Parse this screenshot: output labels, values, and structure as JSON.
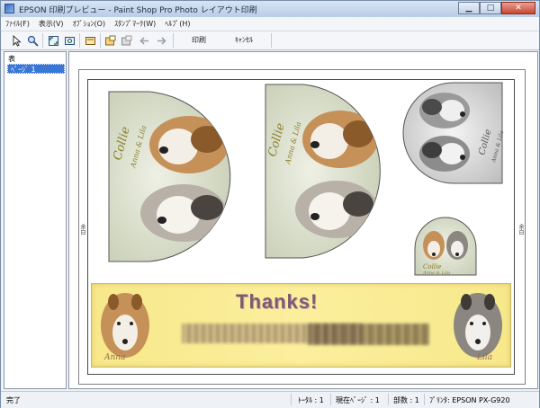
{
  "window": {
    "title": "EPSON 印刷プレビュー - Paint Shop Pro Photo レイアウト印刷"
  },
  "menu": [
    "ﾌｧｲﾙ(F)",
    "表示(V)",
    "ｵﾌﾟｼｮﾝ(O)",
    "ｽﾀﾝﾌﾟﾏｰｸ(W)",
    "ﾍﾙﾌﾟ(H)"
  ],
  "toolbar": {
    "print_label": "印刷",
    "cancel_label": "ｷｬﾝｾﾙ"
  },
  "sidebar": {
    "header": "表",
    "items": [
      "ﾍﾟｰｼﾞ 1"
    ]
  },
  "page": {
    "margin_label": "余白",
    "photos": [
      {
        "text_main": "Collie",
        "text_sub": "Anna & Lila",
        "tone": "color"
      },
      {
        "text_main": "Collie",
        "text_sub": "Anna & Lila",
        "tone": "color"
      },
      {
        "text_main": "Collie",
        "text_sub": "Anna & Lila",
        "tone": "mono"
      },
      {
        "text_main": "Collie",
        "text_sub": "Anna & Lila",
        "tone": "color"
      }
    ],
    "banner": {
      "title": "Thanks!",
      "left_name": "Anna",
      "right_name": "Lila"
    }
  },
  "status": {
    "ready": "完了",
    "total": "ﾄｰﾀﾙ : 1",
    "current": "現在ﾍﾟｰｼﾞ : 1",
    "copies": "部数 : 1",
    "printer": "ﾌﾟﾘﾝﾀ: EPSON PX-G920"
  },
  "colors": {
    "accent": "#3a76d6",
    "banner": "#f7e88a",
    "title_text": "#7c5c6e"
  }
}
